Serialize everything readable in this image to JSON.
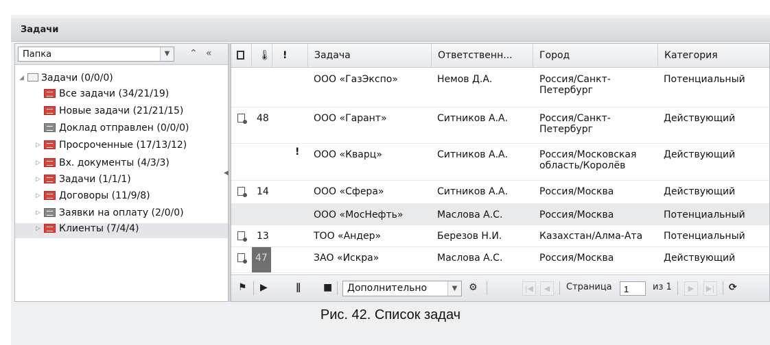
{
  "panel": {
    "title": "Задачи"
  },
  "left_toolbar": {
    "folder_select": "Папка"
  },
  "tree": [
    {
      "label": "Задачи (0/0/0)",
      "icon": "folder-icon",
      "level": 0,
      "expanded": true
    },
    {
      "label": "Все задачи (34/21/19)",
      "icon": "red-filter-icon",
      "level": 1
    },
    {
      "label": "Новые задачи (21/21/15)",
      "icon": "red-filter-icon",
      "level": 1
    },
    {
      "label": "Доклад отправлен (0/0/0)",
      "icon": "grey-filter-icon",
      "level": 1
    },
    {
      "label": "Просроченные (17/13/12)",
      "icon": "red-filter-icon",
      "level": 1,
      "collapsed": true
    },
    {
      "label": "Вх. документы (4/3/3)",
      "icon": "red-filter-icon",
      "level": 1,
      "collapsed": true
    },
    {
      "label": "Задачи (1/1/1)",
      "icon": "red-filter-icon",
      "level": 1,
      "collapsed": true
    },
    {
      "label": "Договоры (11/9/8)",
      "icon": "red-filter-icon",
      "level": 1,
      "collapsed": true
    },
    {
      "label": "Заявки на оплату (2/0/0)",
      "icon": "grey-filter-icon",
      "level": 1,
      "collapsed": true
    },
    {
      "label": "Клиенты (7/4/4)",
      "icon": "red-filter-icon",
      "level": 1,
      "collapsed": true,
      "selected": true
    }
  ],
  "grid": {
    "columns": [
      "Задача",
      "Ответственн...",
      "Город",
      "Категория"
    ],
    "icon_columns": [
      "doc-icon",
      "thermometer-icon",
      "exclamation-icon"
    ],
    "rows": [
      {
        "doc": false,
        "temp": "",
        "urgent": false,
        "task": "ООО «ГазЭкспо»",
        "owner": "Немов Д.А.",
        "city": "Россия/Санкт-Петербург",
        "category": "Потенциальный"
      },
      {
        "doc": true,
        "temp": "48",
        "urgent": false,
        "task": "ООО «Гарант»",
        "owner": "Ситников А.А.",
        "city": "Россия/Санкт-Петербург",
        "category": "Действующий"
      },
      {
        "doc": false,
        "temp": "",
        "urgent": true,
        "task": "ООО «Кварц»",
        "owner": "Ситников А.А.",
        "city": "Россия/Московская область/Королёв",
        "category": "Действующий"
      },
      {
        "doc": true,
        "temp": "14",
        "urgent": false,
        "task": "ООО «Сфера»",
        "owner": "Ситников А.А.",
        "city": "Россия/Москва",
        "category": "Действующий"
      },
      {
        "doc": false,
        "temp": "",
        "urgent": false,
        "task": "ООО «МосНефть»",
        "owner": "Маслова А.С.",
        "city": "Россия/Москва",
        "category": "Потенциальный"
      },
      {
        "doc": true,
        "temp": "13",
        "urgent": false,
        "task": "ТОО «Андер»",
        "owner": "Березов Н.И.",
        "city": "Казахстан/Алма-Ата",
        "category": "Потенциальный"
      },
      {
        "doc": true,
        "temp": "47",
        "urgent": false,
        "task": "ЗАО «Искра»",
        "owner": "Маслова А.С.",
        "city": "Россия/Москва",
        "category": "Действующий"
      }
    ]
  },
  "pager": {
    "more_select": "Дополнительно",
    "page_label": "Страница",
    "page_value": "1",
    "of_label": "из 1"
  },
  "caption": "Рис. 42. Список задач"
}
